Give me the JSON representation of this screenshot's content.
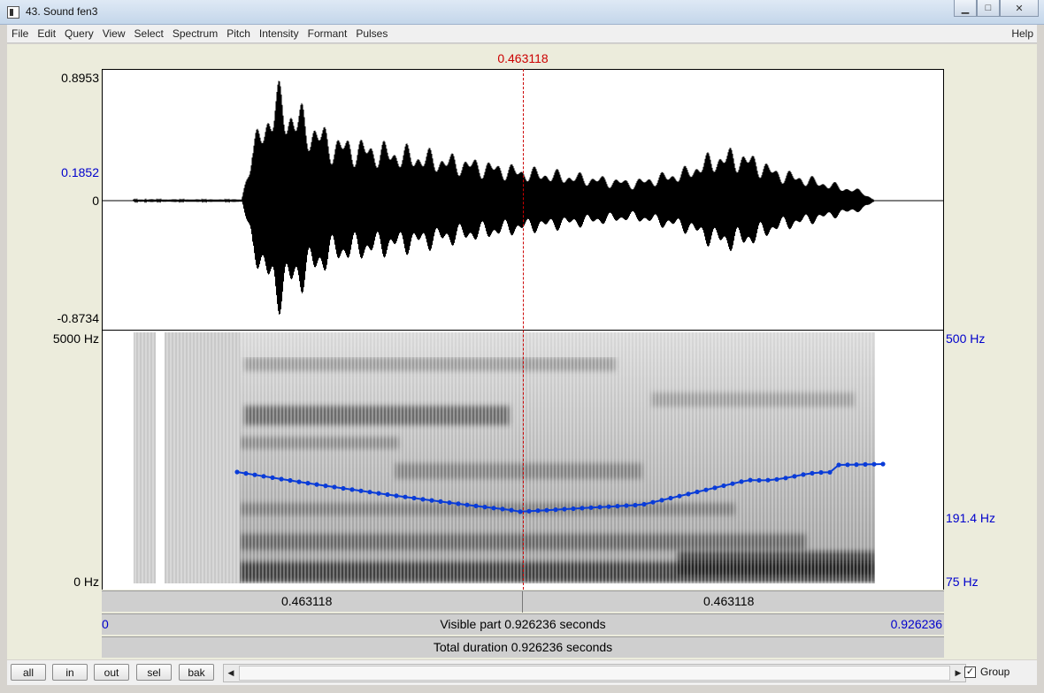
{
  "window": {
    "title": "43. Sound fen3",
    "minimize": "▁",
    "maximize": "□",
    "close": "✕"
  },
  "menu": [
    "File",
    "Edit",
    "Query",
    "View",
    "Select",
    "Spectrum",
    "Pitch",
    "Intensity",
    "Formant",
    "Pulses"
  ],
  "menu_help": "Help",
  "cursor": {
    "time": "0.463118"
  },
  "waveform": {
    "max": "0.8953",
    "mark": "0.1852",
    "zero": "0",
    "min": "-0.8734"
  },
  "spectrogram": {
    "top_freq": "5000 Hz",
    "bottom_freq": "0 Hz"
  },
  "pitch": {
    "top": "500 Hz",
    "value": "191.4 Hz",
    "bottom": "75 Hz",
    "color": "#0a3cd8"
  },
  "timebar": {
    "left": "0.463118",
    "right": "0.463118"
  },
  "visible": {
    "start": "0",
    "text": "Visible part 0.926236 seconds",
    "end": "0.926236"
  },
  "total": {
    "text": "Total duration 0.926236 seconds"
  },
  "buttons": {
    "all": "all",
    "in": "in",
    "out": "out",
    "sel": "sel",
    "bak": "bak"
  },
  "scroll": {
    "left": "◀",
    "right": "▶"
  },
  "group": {
    "label": "Group",
    "checked": "✓"
  }
}
